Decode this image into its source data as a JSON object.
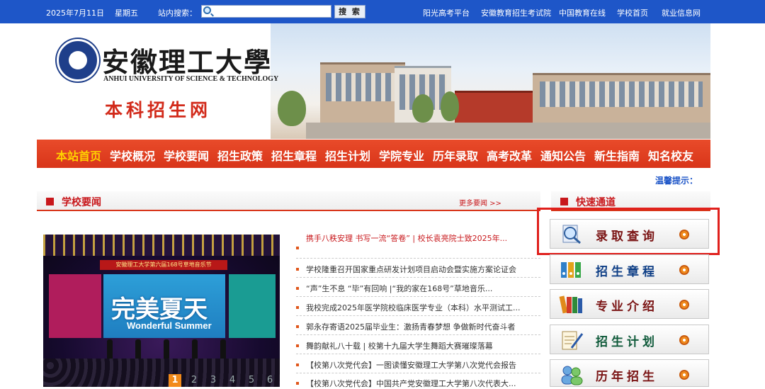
{
  "topbar": {
    "date": "2025年7月11日",
    "weekday": "星期五",
    "search_label": "站内搜索：",
    "search_value": "",
    "search_button": "搜 索",
    "links": [
      "阳光高考平台",
      "安徽教育招生考试院",
      "中国教育在线",
      "学校首页",
      "就业信息网"
    ]
  },
  "header": {
    "logo_cn": "安徽理工大學",
    "logo_en": "ANHUI UNIVERSITY OF SCIENCE & TECHNOLOGY",
    "site_name": "本科招生网"
  },
  "nav": {
    "items": [
      "本站首页",
      "学校概况",
      "学校要闻",
      "招生政策",
      "招生章程",
      "招生计划",
      "学院专业",
      "历年录取",
      "高考改革",
      "通知公告",
      "新生指南",
      "知名校友"
    ],
    "active": "本站首页"
  },
  "tip": "温馨提示：",
  "news": {
    "title": "学校要闻",
    "more": "更多要闻 >>",
    "items": [
      "携手八秩安理 书写一流“答卷” | 校长袁亮院士致2025年...",
      "学校隆重召开国家重点研发计划项目启动会暨实施方案论证会",
      "“声”生不息 “毕”有回响 |“我的家在168号”草地音乐...",
      "我校完成2025年医学院校临床医学专业（本科）水平测试工...",
      "郭永存寄语2025届毕业生：激扬青春梦想 争做新时代奋斗者",
      "舞韵献礼八十载 | 校第十九届大学生舞蹈大赛璀璨落幕",
      "【校第八次党代会】一图读懂安徽理工大学第八次党代会报告",
      "【校第八次党代会】中国共产党安徽理工大学第八次代表大..."
    ]
  },
  "slider": {
    "banner": "安徽理工大学第六届168号草地音乐节",
    "big_text": "完美夏天",
    "sub_text": "Wonderful Summer",
    "pages": [
      "1",
      "2",
      "3",
      "4",
      "5",
      "6"
    ],
    "active_page": "1"
  },
  "quick": {
    "title": "快速通道",
    "items": [
      {
        "label": "录取查询",
        "icon": "magnifier-doc-icon"
      },
      {
        "label": "招生章程",
        "icon": "binders-icon"
      },
      {
        "label": "专业介绍",
        "icon": "books-icon"
      },
      {
        "label": "招生计划",
        "icon": "notepad-pen-icon"
      },
      {
        "label": "历年招生",
        "icon": "people-icon"
      }
    ]
  },
  "colors": {
    "topbar": "#1e56c8",
    "nav": "#d8351a",
    "nav_active": "#ffd200",
    "accent_red": "#c8181c",
    "highlight_box": "#e0201c"
  }
}
